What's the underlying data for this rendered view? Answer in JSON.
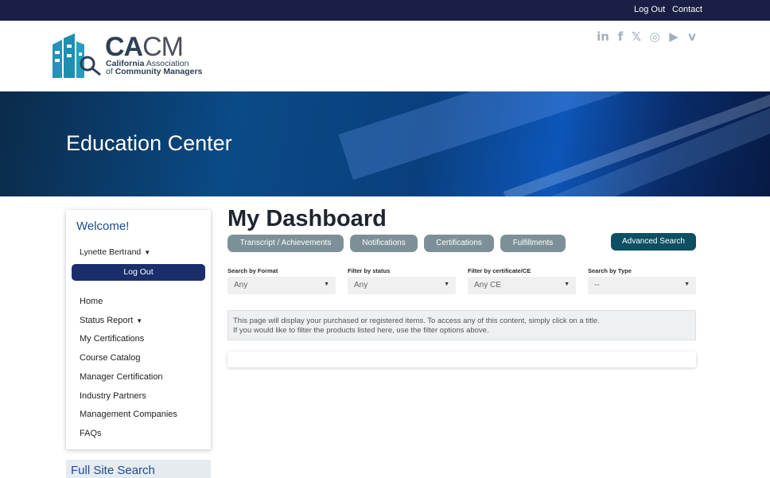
{
  "topbar": {
    "logout": "Log Out",
    "contact": "Contact"
  },
  "logo": {
    "name_bold": "CA",
    "name_thin": "CM",
    "line1_bold": "California",
    "line1_rest": " Association",
    "line2_rest": "of ",
    "line2_bold": "Community Managers"
  },
  "social": [
    {
      "icon": "linkedin-icon",
      "glyph": "in"
    },
    {
      "icon": "facebook-icon",
      "glyph": "f"
    },
    {
      "icon": "x-icon",
      "glyph": "𝕏"
    },
    {
      "icon": "instagram-icon",
      "glyph": "◎"
    },
    {
      "icon": "youtube-icon",
      "glyph": "▶"
    },
    {
      "icon": "vimeo-icon",
      "glyph": "v"
    }
  ],
  "hero": {
    "title": "Education Center"
  },
  "sidebar": {
    "welcome": "Welcome!",
    "username": "Lynette Bertrand",
    "logout": "Log Out",
    "items": [
      {
        "label": "Home"
      },
      {
        "label": "Status Report"
      },
      {
        "label": "My Certifications"
      },
      {
        "label": "Course Catalog"
      },
      {
        "label": "Manager Certification"
      },
      {
        "label": "Industry Partners"
      },
      {
        "label": "Management Companies"
      },
      {
        "label": "FAQs"
      }
    ],
    "full_search": "Full Site Search"
  },
  "main": {
    "title": "My Dashboard",
    "tabs": [
      {
        "label": "Transcript / Achievements"
      },
      {
        "label": "Notifications"
      },
      {
        "label": "Certifications"
      },
      {
        "label": "Fulfillments"
      }
    ],
    "advanced_search": "Advanced Search",
    "filters": [
      {
        "label": "Search by Format",
        "value": "Any"
      },
      {
        "label": "Filter by status",
        "value": "Any"
      },
      {
        "label": "Filter by certificate/CE",
        "value": "Any CE"
      },
      {
        "label": "Search by Type",
        "value": "--"
      }
    ],
    "info_line1": "This page will display your purchased or registered items. To access any of this content, simply click on a title.",
    "info_line2": "If you would like to filter the products listed here, use the filter options above."
  },
  "colors": {
    "topbar": "#1a1f45",
    "accent_blue": "#1b4b8f",
    "logout_button": "#1a2e6b",
    "tab": "#7d9098",
    "advanced_button": "#0d4f63",
    "logo_teal": "#1e8fb0"
  }
}
